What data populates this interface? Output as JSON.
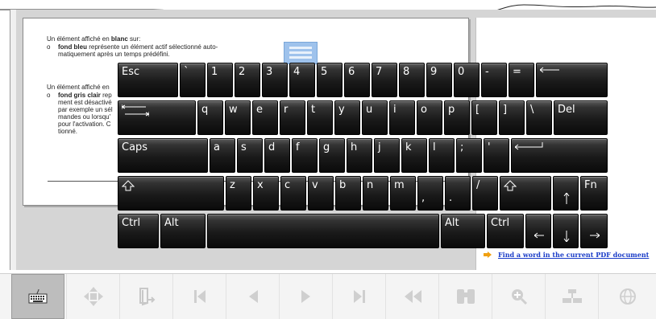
{
  "document": {
    "para1_intro_a": "Un élément affiché en ",
    "para1_intro_b": "blanc",
    "para1_intro_c": " sur:",
    "bullet_glyph": "o",
    "para1_bullet_bold": "fond bleu",
    "para1_bullet_text": " représente un élément actif sélectionné auto-",
    "para1_bullet_line2": "matiquement après un temps prédéfini.",
    "para2_intro": "Un élément affiché en",
    "para2_bullet_bold": "fond gris clair",
    "para2_bullet_text": " rep",
    "para2_line2": "ment est désactivé",
    "para2_line3": "par exemple un sél",
    "para2_line4": "mandes ou lorsqu'",
    "para2_line5": "pour l'activation. C",
    "para2_line6": "tionné."
  },
  "side_panel": {
    "hint_link": "Find a word in the current PDF document"
  },
  "keyboard": {
    "rows": [
      [
        "Esc",
        "`",
        "1",
        "2",
        "3",
        "4",
        "5",
        "6",
        "7",
        "8",
        "9",
        "0",
        "-",
        "=",
        "Backspace"
      ],
      [
        "Tab",
        "q",
        "w",
        "e",
        "r",
        "t",
        "y",
        "u",
        "i",
        "o",
        "p",
        "[",
        "]",
        "\\",
        "Del"
      ],
      [
        "Caps",
        "a",
        "s",
        "d",
        "f",
        "g",
        "h",
        "j",
        "k",
        "l",
        ";",
        "'",
        "Enter"
      ],
      [
        "Shift",
        "z",
        "x",
        "c",
        "v",
        "b",
        "n",
        "m",
        ",",
        ".",
        "/",
        "Shift",
        "Up",
        "Fn"
      ],
      [
        "Ctrl",
        "Alt",
        "Space",
        "Alt",
        "Ctrl",
        "Left",
        "Down",
        "Right"
      ]
    ],
    "labels": {
      "esc": "Esc",
      "backtick": "`",
      "k1": "1",
      "k2": "2",
      "k3": "3",
      "k4": "4",
      "k5": "5",
      "k6": "6",
      "k7": "7",
      "k8": "8",
      "k9": "9",
      "k0": "0",
      "minus": "-",
      "equals": "=",
      "q": "q",
      "w": "w",
      "e": "e",
      "r": "r",
      "t": "t",
      "y": "y",
      "u": "u",
      "i": "i",
      "o": "o",
      "p": "p",
      "lbracket": "[",
      "rbracket": "]",
      "backslash": "\\",
      "del": "Del",
      "caps": "Caps",
      "a": "a",
      "s": "s",
      "d": "d",
      "f": "f",
      "g": "g",
      "h": "h",
      "j": "j",
      "k": "k",
      "l": "l",
      "semicolon": ";",
      "quote": "'",
      "z": "z",
      "x": "x",
      "c": "c",
      "v": "v",
      "b": "b",
      "n": "n",
      "m": "m",
      "comma": ",",
      "period": ".",
      "slash": "/",
      "fn": "Fn",
      "ctrl": "Ctrl",
      "alt": "Alt"
    }
  },
  "toolbar": {
    "buttons": [
      "keyboard-icon",
      "navigate-icon",
      "exit-icon",
      "first-page-icon",
      "previous-icon",
      "next-icon",
      "last-page-icon",
      "back-icon",
      "find-icon",
      "zoom-in-icon",
      "layout-icon",
      "globe-icon"
    ]
  },
  "colors": {
    "key_face": "#1a1a1a",
    "key_text": "#ffffff",
    "link": "#1a3cc8",
    "hint_arrow": "#f0a010"
  }
}
